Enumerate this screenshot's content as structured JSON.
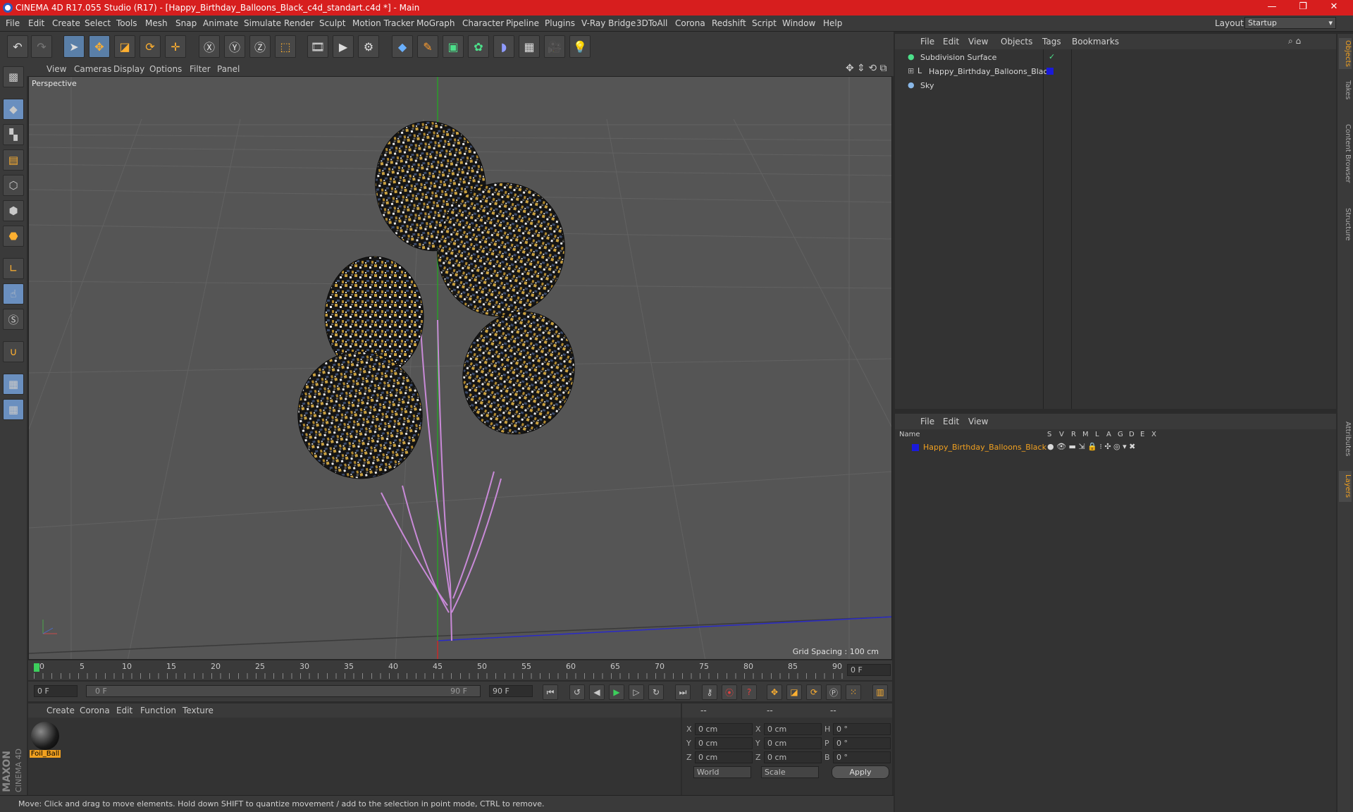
{
  "window": {
    "title": "CINEMA 4D R17.055 Studio (R17) - [Happy_Birthday_Balloons_Black_c4d_standart.c4d *] - Main"
  },
  "menu": [
    "File",
    "Edit",
    "Create",
    "Select",
    "Tools",
    "Mesh",
    "Snap",
    "Animate",
    "Simulate",
    "Render",
    "Sculpt",
    "Motion Tracker",
    "MoGraph",
    "Character",
    "Pipeline",
    "Plugins",
    "V-Ray Bridge",
    "3DToAll",
    "Corona",
    "Redshift",
    "Script",
    "Window",
    "Help"
  ],
  "layout": {
    "label": "Layout:",
    "value": "Startup"
  },
  "viewport": {
    "menu": [
      "View",
      "Cameras",
      "Display",
      "Options",
      "Filter",
      "Panel"
    ],
    "label": "Perspective",
    "grid_spacing": "Grid Spacing : 100 cm"
  },
  "timeline": {
    "ticks": [
      "0",
      "5",
      "10",
      "15",
      "20",
      "25",
      "30",
      "35",
      "40",
      "45",
      "50",
      "55",
      "60",
      "65",
      "70",
      "75",
      "80",
      "85",
      "90"
    ],
    "frame_field": "0 F"
  },
  "transport": {
    "start": "0 F",
    "range_start": "0 F",
    "range_end": "90 F",
    "end": "90 F"
  },
  "material": {
    "menu": [
      "Create",
      "Corona",
      "Edit",
      "Function",
      "Texture"
    ],
    "name": "Foil_Ball"
  },
  "coords": {
    "headers": [
      "--",
      "--",
      "--"
    ],
    "rows": [
      {
        "a": "X",
        "av": "0 cm",
        "b": "X",
        "bv": "0 cm",
        "c": "H",
        "cv": "0 °"
      },
      {
        "a": "Y",
        "av": "0 cm",
        "b": "Y",
        "bv": "0 cm",
        "c": "P",
        "cv": "0 °"
      },
      {
        "a": "Z",
        "av": "0 cm",
        "b": "Z",
        "bv": "0 cm",
        "c": "B",
        "cv": "0 °"
      }
    ],
    "world": "World",
    "scale": "Scale",
    "apply": "Apply"
  },
  "objects": {
    "menu": [
      "File",
      "Edit",
      "View",
      "Objects",
      "Tags",
      "Bookmarks"
    ],
    "items": [
      "Subdivision Surface",
      "Happy_Birthday_Balloons_Black",
      "Sky"
    ]
  },
  "layers": {
    "menu": [
      "File",
      "Edit",
      "View"
    ],
    "name_header": "Name",
    "cols": [
      "S",
      "V",
      "R",
      "M",
      "L",
      "A",
      "G",
      "D",
      "E",
      "X"
    ],
    "item": "Happy_Birthday_Balloons_Black"
  },
  "right_tabs": [
    "Objects",
    "Takes",
    "Content Browser",
    "Structure",
    "Attributes",
    "Layers"
  ],
  "status": "Move: Click and drag to move elements. Hold down SHIFT to quantize movement / add to the selection in point mode, CTRL to remove.",
  "branding": {
    "line1": "MAXON",
    "line2": "CINEMA 4D"
  },
  "colors": {
    "title_bar": "#d71e1e",
    "selection": "#5a7fa8",
    "layer_color": "#1a1adb",
    "highlight_text": "#f0a020"
  },
  "icons": [
    "undo-icon",
    "redo-icon",
    "select-icon",
    "move-icon",
    "scale-icon",
    "rotate-icon",
    "x-axis-icon",
    "y-axis-icon",
    "z-axis-icon",
    "coords-icon",
    "render-view-icon",
    "render-icon",
    "render-settings-icon",
    "cube-icon",
    "pen-icon",
    "subdivision-icon",
    "cloner-icon",
    "deformer-icon",
    "floor-icon",
    "camera-icon",
    "light-icon"
  ]
}
